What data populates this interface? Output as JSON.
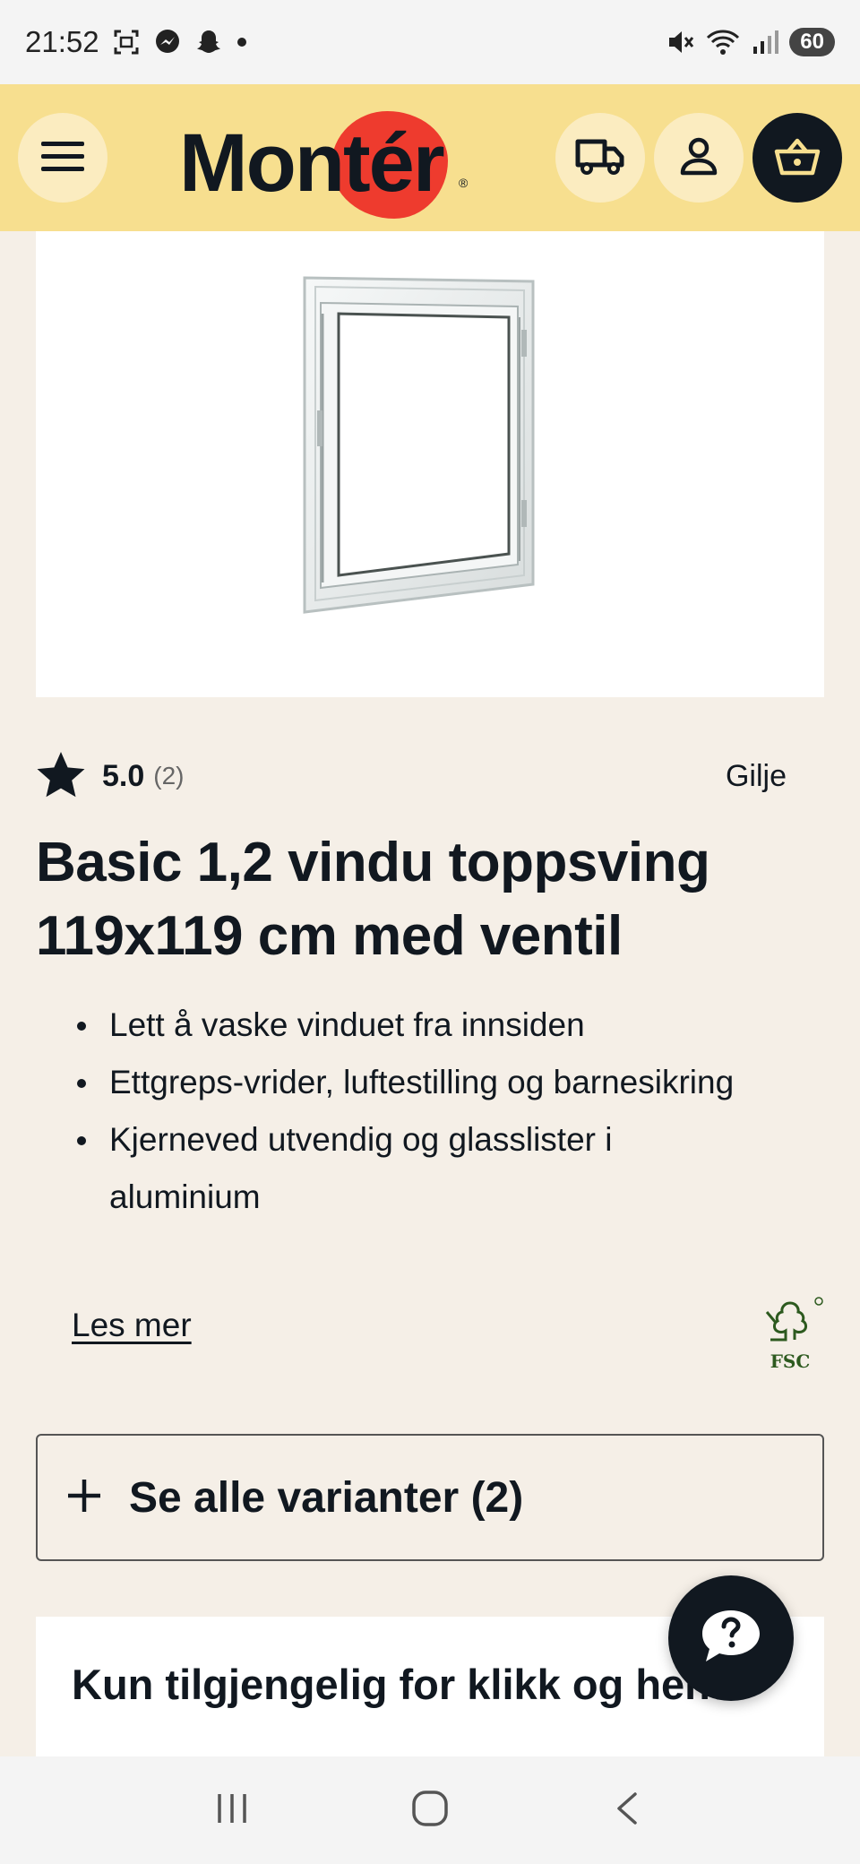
{
  "status_bar": {
    "time": "21:52",
    "battery": "60",
    "icons": [
      "screenshot-icon",
      "messenger-icon",
      "snapchat-icon",
      "dot-icon",
      "mute-icon",
      "wifi-icon",
      "signal-icon"
    ]
  },
  "header": {
    "logo_text": "Montér",
    "logo_mark": "®",
    "brand_color": "#f7df8f",
    "accent_color": "#ee3b2e",
    "icons": [
      "menu-icon",
      "truck-icon",
      "user-icon",
      "basket-icon"
    ]
  },
  "product": {
    "rating": "5.0",
    "review_count": "(2)",
    "store": "Gilje",
    "title": "Basic 1,2 vindu toppsving 119x119 cm med ventil",
    "features": [
      "Lett å vaske vinduet fra innsiden",
      "Ettgreps-vrider, luftestilling og barnesikring",
      "Kjerneved utvendig og glasslister i aluminium"
    ],
    "read_more": "Les mer",
    "fsc_label": "FSC"
  },
  "variants": {
    "label": "Se alle varianter (2)"
  },
  "availability": {
    "text": "Kun tilgjengelig for klikk og hent"
  },
  "help": {
    "icon": "question-chat-icon"
  },
  "nav": {
    "icons": [
      "recent-apps-icon",
      "home-icon",
      "back-icon"
    ]
  }
}
